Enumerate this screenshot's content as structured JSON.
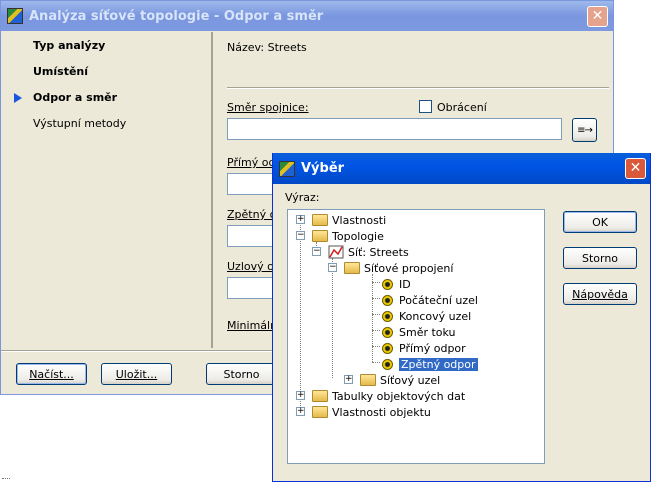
{
  "main_window": {
    "title": "Analýza síťové topologie - Odpor a směr",
    "nav": [
      {
        "label": "Typ analýzy"
      },
      {
        "label": "Umístění"
      },
      {
        "label": "Odpor a směr"
      },
      {
        "label": "Výstupní metody"
      }
    ],
    "name_label": "Název: Streets",
    "direction_label": "Směr spojnice:",
    "reverse_label": "Obrácení",
    "forward_label": "Přímý odp",
    "backward_label": "Zpětný od",
    "node_label": "Uzlový od",
    "minimal_label": "Minimální",
    "buttons": {
      "load": "Načíst...",
      "save": "Uložit...",
      "cancel": "Storno"
    }
  },
  "dialog": {
    "title": "Výběr",
    "expression_label": "Výraz:",
    "buttons": {
      "ok": "OK",
      "cancel": "Storno",
      "help": "Nápověda"
    },
    "tree": {
      "properties": "Vlastnosti",
      "topology": "Topologie",
      "network": "Síť: Streets",
      "links": "Síťové propojení",
      "fields": [
        "ID",
        "Počáteční uzel",
        "Koncový uzel",
        "Směr toku",
        "Přímý odpor",
        "Zpětný odpor"
      ],
      "selected_field": "Zpětný odpor",
      "node": "Síťový uzel",
      "object_tables": "Tabulky objektových dat",
      "object_properties": "Vlastnosti objektu"
    }
  },
  "colors": {
    "window_bg": "#ece9d8",
    "title_active": "#0055e5",
    "title_inactive": "#7a96df",
    "selection": "#316ac5",
    "close": "#d9593a"
  }
}
